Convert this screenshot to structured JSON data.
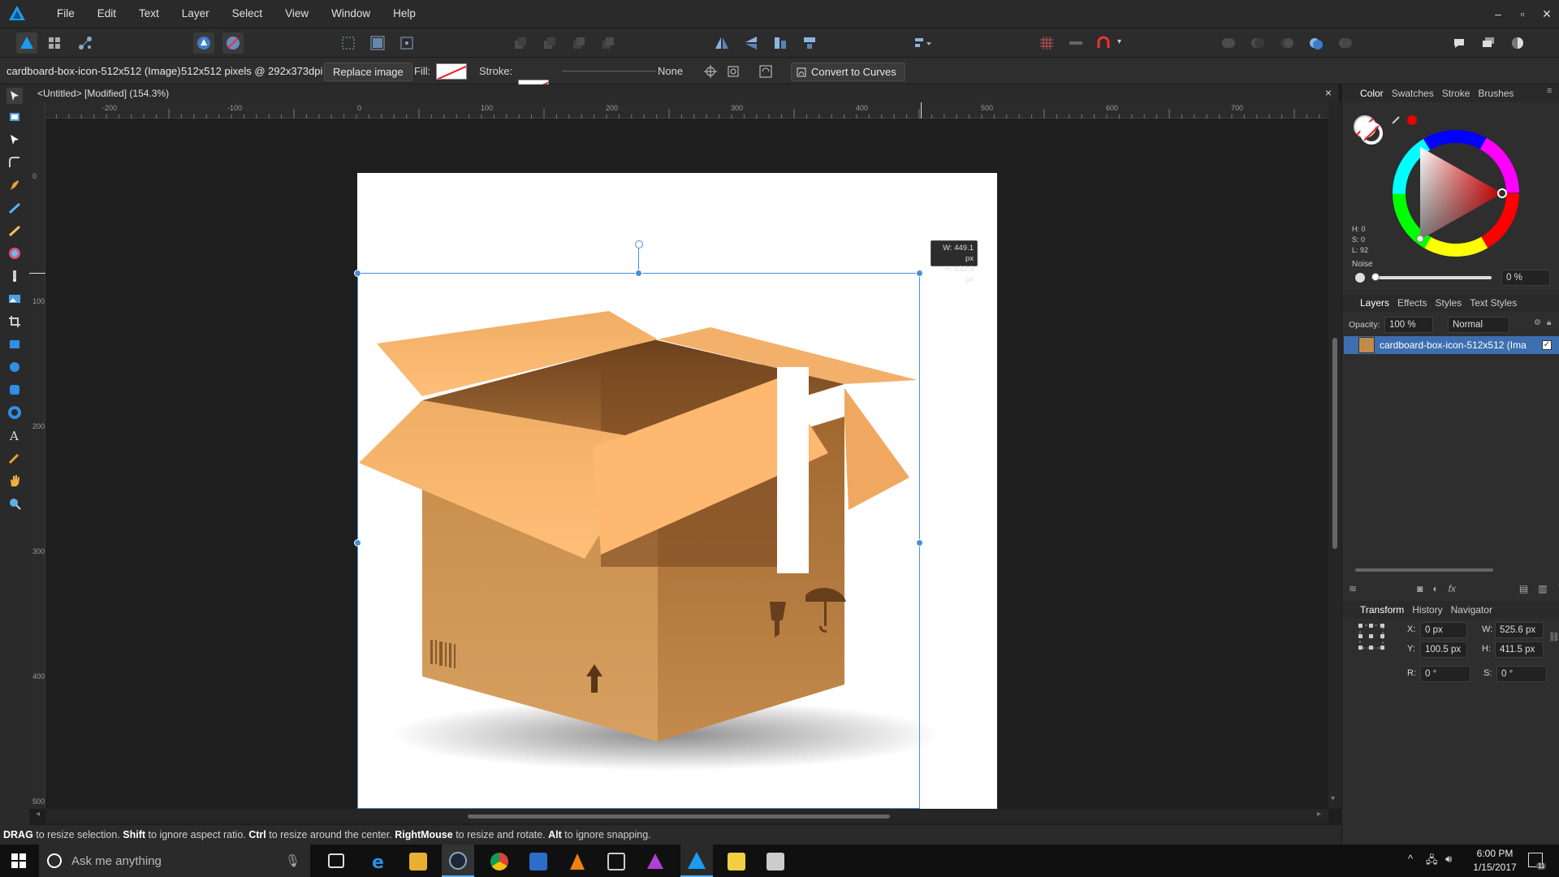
{
  "app": {
    "menu": [
      "File",
      "Edit",
      "Text",
      "Layer",
      "Select",
      "View",
      "Window",
      "Help"
    ],
    "window_controls": [
      "–",
      "▫",
      "✕"
    ]
  },
  "context": {
    "layer_name": "cardboard-box-icon-512x512 (Image)",
    "dimensions": "512x512 pixels @ 292x373dpi",
    "replace_image": "Replace image",
    "fill_label": "Fill:",
    "stroke_label": "Stroke:",
    "stroke_style": "None",
    "convert_to_curves": "Convert to Curves"
  },
  "document": {
    "tab_title": "<Untitled> [Modified] (154.3%)",
    "close": "×"
  },
  "rulers": {
    "h_labels": [
      "-200",
      "-100",
      "0",
      "100",
      "200",
      "300",
      "400",
      "500",
      "600",
      "700"
    ],
    "v_labels": [
      "0",
      "100",
      "200",
      "300",
      "400",
      "500"
    ]
  },
  "selection": {
    "width_readout": "W: 449.1 px",
    "height_readout": "H: 432.3 px"
  },
  "statusbar": {
    "k1": "DRAG",
    "t1": " to resize selection. ",
    "k2": "Shift",
    "t2": " to ignore aspect ratio. ",
    "k3": "Ctrl",
    "t3": " to resize around the center. ",
    "k4": "RightMouse",
    "t4": " to resize and rotate. ",
    "k5": "Alt",
    "t5": " to ignore snapping."
  },
  "color_panel": {
    "tabs": [
      "Color",
      "Swatches",
      "Stroke",
      "Brushes"
    ],
    "h": "H: 0",
    "s": "S: 0",
    "l": "L: 92",
    "noise_label": "Noise",
    "noise_value": "0 %",
    "noise_level": 0
  },
  "layers_panel": {
    "tabs": [
      "Layers",
      "Effects",
      "Styles",
      "Text Styles"
    ],
    "opacity_label": "Opacity:",
    "opacity_value": "100 %",
    "blend_mode": "Normal",
    "layer_name": "cardboard-box-icon-512x512 (Ima"
  },
  "transform_panel": {
    "tabs": [
      "Transform",
      "History",
      "Navigator"
    ],
    "x_label": "X:",
    "x": "0 px",
    "y_label": "Y:",
    "y": "100.5 px",
    "w_label": "W:",
    "w": "525.6 px",
    "h_label": "H:",
    "h": "411.5 px",
    "r_label": "R:",
    "r": "0 °",
    "s_label": "S:",
    "s": "0 °"
  },
  "taskbar": {
    "search_placeholder": "Ask me anything",
    "time": "6:00 PM",
    "date": "1/15/2017",
    "notification_count": "11"
  },
  "colors": {
    "accent": "#3a7bd5",
    "selection": "#4a90d9",
    "box_light": "#f5b46a",
    "box_mid": "#c98a4a",
    "box_dark": "#7a4a22"
  }
}
